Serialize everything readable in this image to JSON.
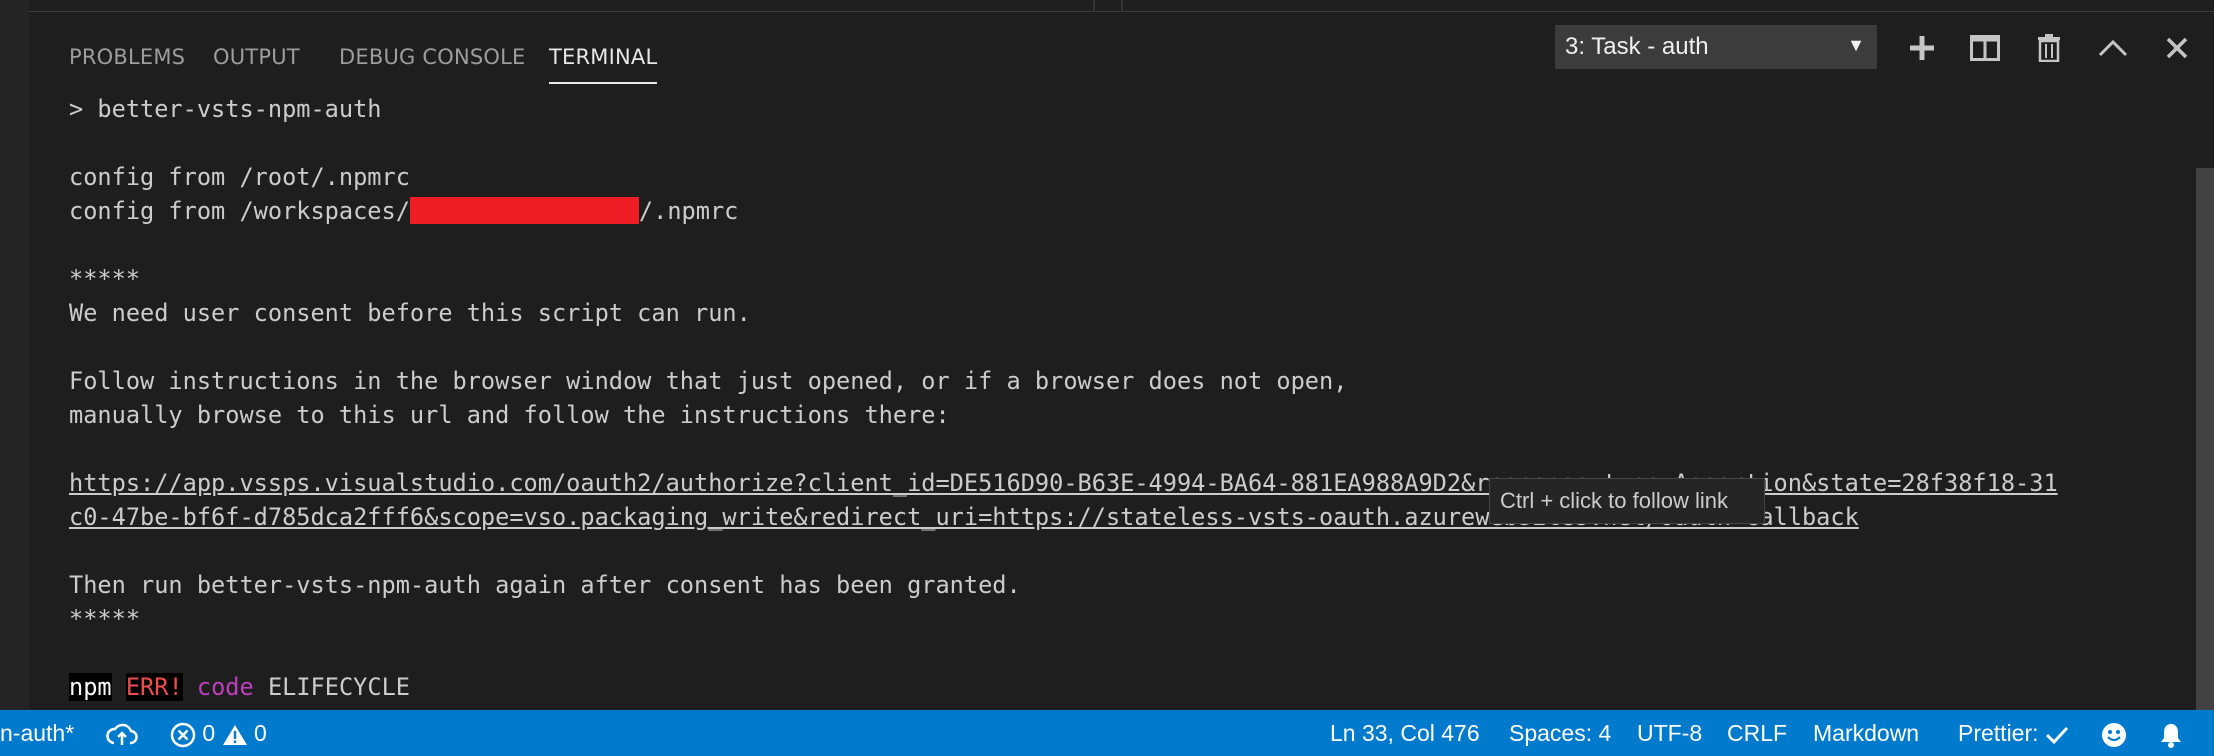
{
  "panel": {
    "tabs": [
      {
        "label": "PROBLEMS"
      },
      {
        "label": "OUTPUT"
      },
      {
        "label": "DEBUG CONSOLE"
      },
      {
        "label": "TERMINAL",
        "active": true
      }
    ],
    "task_select": {
      "value": "3: Task - auth"
    },
    "icons": [
      "plus-icon",
      "split-icon",
      "trash-icon",
      "chevron-up-icon",
      "close-icon"
    ]
  },
  "terminal": {
    "line1": "> better-vsts-npm-auth",
    "line2": "config from /root/.npmrc",
    "line3_prefix": "config from /workspaces/",
    "line3_suffix": "/.npmrc",
    "line4": "*****",
    "line5": "We need user consent before this script can run.",
    "line6": "Follow instructions in the browser window that just opened, or if a browser does not open,",
    "line7": "manually browse to this url and follow the instructions there:",
    "url_line1": "https://app.vssps.visualstudio.com/oauth2/authorize?client_id=DE516D90-B63E-4994-BA64-881EA988A9D2&response_type=Assertion&state=28f38f18-31",
    "url_line2": "c0-47be-bf6f-d785dca2fff6&scope=vso.packaging_write&redirect_uri=https://stateless-vsts-oauth.azurewebsites.net/oauth-callback",
    "line8": "Then run better-vsts-npm-auth again after consent has been granted.",
    "line9": "*****",
    "err_npm": "npm",
    "err_err": "ERR!",
    "err_code": "code",
    "err_value": "ELIFECYCLE"
  },
  "tooltip": {
    "text": "Ctrl + click to follow link"
  },
  "status_bar": {
    "branch": "n-auth*",
    "errors": "0",
    "warnings": "0",
    "position": "Ln 33, Col 476",
    "spaces": "Spaces: 4",
    "encoding": "UTF-8",
    "eol": "CRLF",
    "language": "Markdown",
    "prettier": "Prettier:"
  },
  "colors": {
    "status_bg": "#007acc",
    "panel_bg": "#1e1e1e",
    "redaction": "#ee1c24",
    "err_red": "#f14c4c",
    "code_magenta": "#bc3fbc"
  }
}
